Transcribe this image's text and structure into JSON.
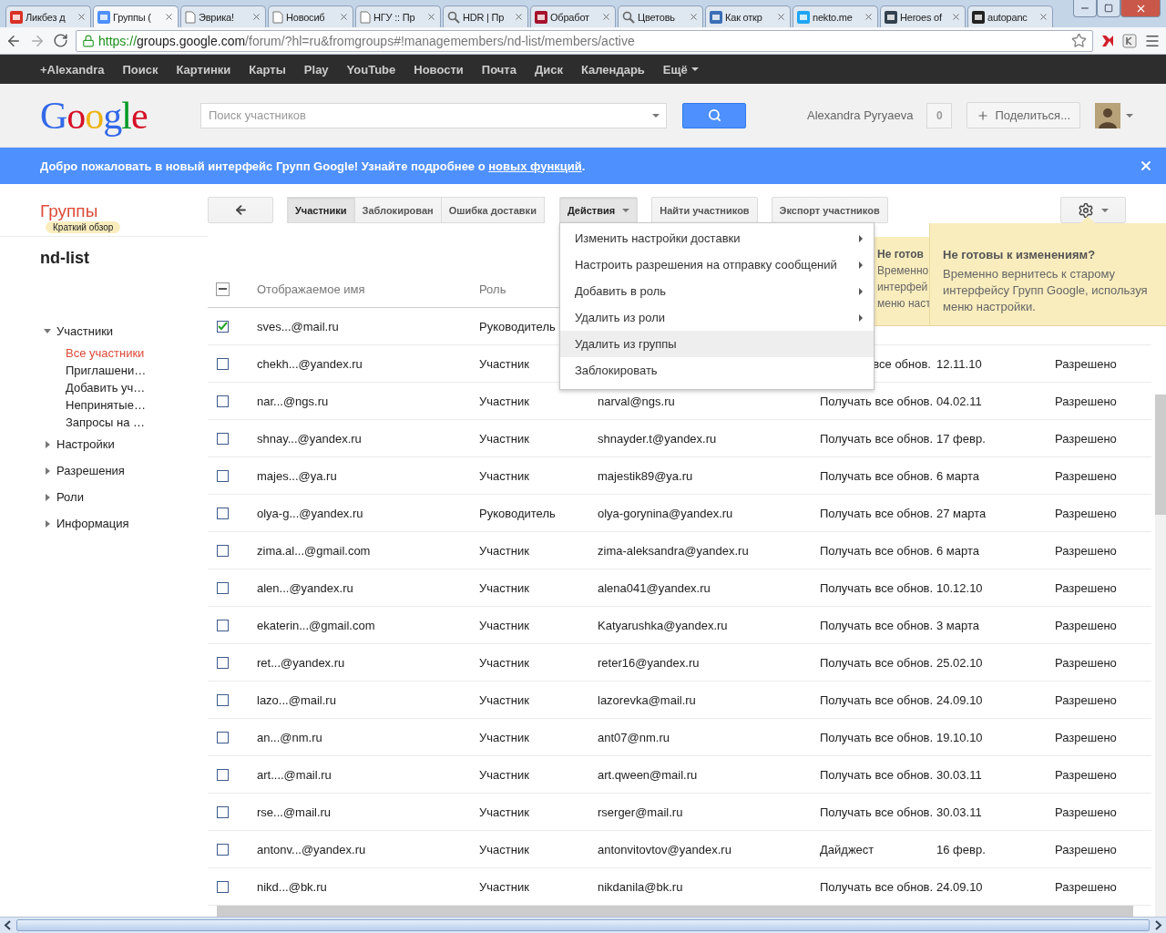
{
  "browser": {
    "tabs": [
      {
        "title": "Ликбез д",
        "selected": false
      },
      {
        "title": "Группы (",
        "selected": true
      },
      {
        "title": "Эврика!",
        "selected": false
      },
      {
        "title": "Новосиб",
        "selected": false
      },
      {
        "title": "НГУ :: Пр",
        "selected": false
      },
      {
        "title": "HDR | Пр",
        "selected": false
      },
      {
        "title": "Обработ",
        "selected": false
      },
      {
        "title": "Цветовь",
        "selected": false
      },
      {
        "title": "Как откр",
        "selected": false
      },
      {
        "title": "nekto.me",
        "selected": false
      },
      {
        "title": "Heroes of",
        "selected": false
      },
      {
        "title": "autopanc",
        "selected": false
      }
    ],
    "url": {
      "scheme": "https://",
      "host": "groups.google.com",
      "path": "/forum/?hl=ru&fromgroups#!managemembers/nd-list/members/active"
    }
  },
  "google_bar": {
    "items": [
      "+Alexandra",
      "Поиск",
      "Картинки",
      "Карты",
      "Play",
      "YouTube",
      "Новости",
      "Почта",
      "Диск",
      "Календарь"
    ],
    "more": "Ещё"
  },
  "header": {
    "logo": "Google",
    "search": {
      "placeholder": "Поиск участников"
    },
    "user": "Alexandra Pyryaeva",
    "notifications": "0",
    "share": "Поделиться..."
  },
  "banner": {
    "text": "Добро пожаловать в новый интерфейс Групп Google! Узнайте подробнее о ",
    "link": "новых функций",
    "end": "."
  },
  "app": {
    "title": "Группы",
    "badge": "Краткий обзор",
    "group_name": "nd-list"
  },
  "sidebar": {
    "items": [
      {
        "label": "Участники",
        "expanded": true,
        "selected": false,
        "children": [
          {
            "label": "Все участники",
            "selected": true
          },
          {
            "label": "Приглашени…",
            "selected": false
          },
          {
            "label": "Добавить уч…",
            "selected": false
          },
          {
            "label": "Непринятые…",
            "selected": false
          },
          {
            "label": "Запросы на …",
            "selected": false
          }
        ]
      },
      {
        "label": "Настройки",
        "expanded": false,
        "selected": false
      },
      {
        "label": "Разрешения",
        "expanded": false,
        "selected": false
      },
      {
        "label": "Роли",
        "expanded": false,
        "selected": false
      },
      {
        "label": "Информация",
        "expanded": false,
        "selected": false
      }
    ]
  },
  "toolbar": {
    "segments": [
      {
        "label": "Участники",
        "selected": true
      },
      {
        "label": "Заблокирован",
        "selected": false
      },
      {
        "label": "Ошибка доставки",
        "selected": false
      }
    ],
    "actions": "Действия",
    "find": "Найти участников",
    "export": "Экспорт участников"
  },
  "actions_menu": {
    "open": true,
    "items": [
      {
        "label": "Изменить настройки доставки",
        "submenu": true,
        "selected": false
      },
      {
        "label": "Настроить разрешения на отправку сообщений",
        "submenu": true,
        "selected": false
      },
      {
        "label": "Добавить в роль",
        "submenu": true,
        "selected": false
      },
      {
        "label": "Удалить из роли",
        "submenu": true,
        "selected": false
      },
      {
        "label": "Удалить из группы",
        "submenu": false,
        "selected": true
      },
      {
        "label": "Заблокировать",
        "submenu": false,
        "selected": false
      }
    ]
  },
  "tooltip": {
    "title": "Не готовы к изменениям?",
    "body": "Временно вернитесь к старому интерфейсу Групп Google, используя меню настройки."
  },
  "tooltip_behind": {
    "lines": [
      "Не готов",
      "Временно",
      "интерфей",
      "меню наст"
    ]
  },
  "table": {
    "select_all": {
      "partial": true
    },
    "columns": [
      "Отображаемое имя",
      "Роль"
    ],
    "rows": [
      {
        "checked": true,
        "name": "sves...@mail.ru",
        "role": "Руководитель"
      },
      {
        "checked": false,
        "name": "chekh...@yandex.ru",
        "role": "Участник",
        "delivery": "все обнов.",
        "delivery_clipped": true,
        "date": "12.11.10",
        "permission": "Разрешено"
      },
      {
        "checked": false,
        "name": "nar...@ngs.ru",
        "role": "Участник",
        "email": "narval@ngs.ru",
        "delivery": "Получать все обнов.",
        "date": "04.02.11",
        "permission": "Разрешено"
      },
      {
        "checked": false,
        "name": "shnay...@yandex.ru",
        "role": "Участник",
        "email": "shnayder.t@yandex.ru",
        "delivery": "Получать все обнов.",
        "date": "17 февр.",
        "permission": "Разрешено"
      },
      {
        "checked": false,
        "name": "majes...@ya.ru",
        "role": "Участник",
        "email": "majestik89@ya.ru",
        "delivery": "Получать все обнов.",
        "date": "6 марта",
        "permission": "Разрешено"
      },
      {
        "checked": false,
        "name": "olya-g...@yandex.ru",
        "role": "Руководитель",
        "email": "olya-gorynina@yandex.ru",
        "delivery": "Получать все обнов.",
        "date": "27 марта",
        "permission": "Разрешено"
      },
      {
        "checked": false,
        "name": "zima.al...@gmail.com",
        "role": "Участник",
        "email": "zima-aleksandra@yandex.ru",
        "delivery": "Получать все обнов.",
        "date": "6 марта",
        "permission": "Разрешено"
      },
      {
        "checked": false,
        "name": "alen...@yandex.ru",
        "role": "Участник",
        "email": "alena041@yandex.ru",
        "delivery": "Получать все обнов.",
        "date": "10.12.10",
        "permission": "Разрешено"
      },
      {
        "checked": false,
        "name": "ekaterin...@gmail.com",
        "role": "Участник",
        "email": "Katyarushka@yandex.ru",
        "delivery": "Получать все обнов.",
        "date": "3 марта",
        "permission": "Разрешено"
      },
      {
        "checked": false,
        "name": "ret...@yandex.ru",
        "role": "Участник",
        "email": "reter16@yandex.ru",
        "delivery": "Получать все обнов.",
        "date": "25.02.10",
        "permission": "Разрешено"
      },
      {
        "checked": false,
        "name": "lazo...@mail.ru",
        "role": "Участник",
        "email": "lazorevka@mail.ru",
        "delivery": "Получать все обнов.",
        "date": "24.09.10",
        "permission": "Разрешено"
      },
      {
        "checked": false,
        "name": "an...@nm.ru",
        "role": "Участник",
        "email": "ant07@nm.ru",
        "delivery": "Получать все обнов.",
        "date": "19.10.10",
        "permission": "Разрешено"
      },
      {
        "checked": false,
        "name": "art....@mail.ru",
        "role": "Участник",
        "email": "art.qween@mail.ru",
        "delivery": "Получать все обнов.",
        "date": "30.03.11",
        "permission": "Разрешено"
      },
      {
        "checked": false,
        "name": "rse...@mail.ru",
        "role": "Участник",
        "email": "rserger@mail.ru",
        "delivery": "Получать все обнов.",
        "date": "30.03.11",
        "permission": "Разрешено"
      },
      {
        "checked": false,
        "name": "antonv...@yandex.ru",
        "role": "Участник",
        "email": "antonvitovtov@yandex.ru",
        "delivery": "Дайджест",
        "date": "16 февр.",
        "permission": "Разрешено"
      },
      {
        "checked": false,
        "name": "nikd...@bk.ru",
        "role": "Участник",
        "email": "nikdanila@bk.ru",
        "delivery": "Получать все обнов.",
        "date": "24.09.10",
        "permission": "Разрешено"
      }
    ]
  }
}
